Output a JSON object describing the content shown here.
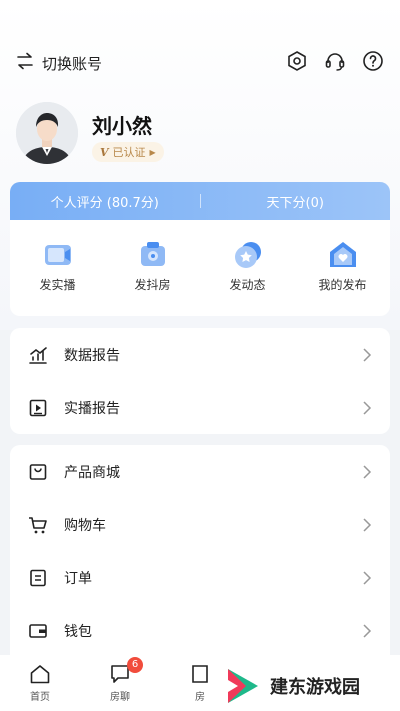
{
  "header": {
    "switch_label": "切换账号"
  },
  "profile": {
    "name": "刘小然",
    "badge_mark": "V",
    "badge_label": "已认证"
  },
  "score_bar": {
    "personal_score": "个人评分 (80.7分)",
    "world_score": "天下分(0)"
  },
  "quick_actions": [
    {
      "label": "发实播",
      "icon": "live-video-icon"
    },
    {
      "label": "发抖房",
      "icon": "camera-house-icon"
    },
    {
      "label": "发动态",
      "icon": "star-bubble-icon"
    },
    {
      "label": "我的发布",
      "icon": "heart-house-icon"
    }
  ],
  "menu_group_1": [
    {
      "label": "数据报告",
      "icon": "bar-chart-icon"
    },
    {
      "label": "实播报告",
      "icon": "play-report-icon"
    }
  ],
  "menu_group_2": [
    {
      "label": "产品商城",
      "icon": "shop-bag-icon"
    },
    {
      "label": "购物车",
      "icon": "cart-icon"
    },
    {
      "label": "订单",
      "icon": "order-list-icon"
    },
    {
      "label": "钱包",
      "icon": "wallet-icon"
    }
  ],
  "tabbar": [
    {
      "label": "首页",
      "icon": "home-icon"
    },
    {
      "label": "房聊",
      "icon": "chat-icon",
      "badge": "6"
    },
    {
      "label": "房",
      "icon": "house-icon"
    }
  ],
  "watermark": {
    "text": "建东游戏园"
  },
  "colors": {
    "accent": "#78aef5",
    "badge_red": "#f14c3c",
    "gold": "#b8884a"
  }
}
